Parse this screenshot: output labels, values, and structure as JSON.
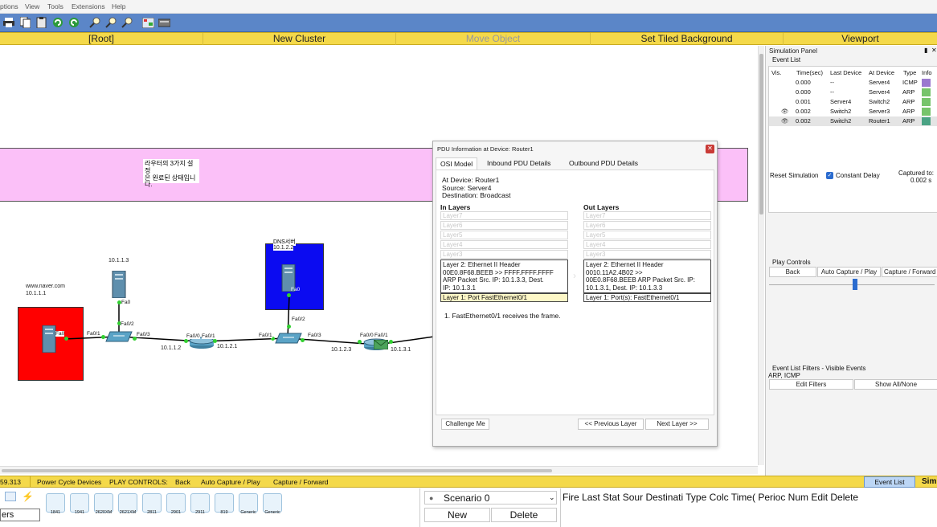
{
  "menu": [
    "ptions",
    "View",
    "Tools",
    "Extensions",
    "Help"
  ],
  "toolbar_icons": [
    "print-icon",
    "copy-icon",
    "paste-icon",
    "undo-icon",
    "redo-icon",
    "zoom-in-icon",
    "zoom-reset-icon",
    "zoom-out-icon",
    "palette-icon",
    "custom-device-icon"
  ],
  "nav": {
    "root": "[Root]",
    "new_cluster": "New Cluster",
    "move_object": "Move Object",
    "set_tiled_background": "Set Tiled Background",
    "viewport": "Viewport"
  },
  "workspace": {
    "note_text": [
      "라우터의 3가지 설정",
      "은 완료된 상태입니",
      "다."
    ],
    "labels": {
      "naver_host": "www.naver.com",
      "naver_ip": "10.1.1.1",
      "server_ip": "10.1.1.3",
      "dns_name": "DNS서버",
      "dns_ip": "10.1.2.2",
      "r1_ip_left": "10.1.1.2",
      "r1_ip_right": "10.1.2.1",
      "r2_ip_left": "10.1.2.3",
      "r2_ip_right": "10.1.3.1"
    },
    "ports": {
      "p_naver": "Fa0",
      "p_s1_left": "Fa0/1",
      "p_s1_top": "Fa0/2",
      "p_s1_right": "Fa0/3",
      "p_srv_bottom": "Fa0",
      "p_r1_left": "Fa0/0",
      "p_r1_right": "Fa0/1",
      "p_dns": "Fa0",
      "p_s2_left": "Fa0/1",
      "p_s2_top": "Fa0/2",
      "p_s2_right": "Fa0/3",
      "p_r2_left": "Fa0/0",
      "p_r2_right": "Fa0/1"
    }
  },
  "sim_panel": {
    "title": "Simulation Panel",
    "event_list_label": "Event List",
    "columns": [
      "Vis.",
      "Time(sec)",
      "Last Device",
      "At Device",
      "Type",
      "Info"
    ],
    "events": [
      {
        "vis": "",
        "time": "0.000",
        "last": "--",
        "at": "Server4",
        "type": "ICMP",
        "color": "#9b79cf"
      },
      {
        "vis": "",
        "time": "0.000",
        "last": "--",
        "at": "Server4",
        "type": "ARP",
        "color": "#77c46b"
      },
      {
        "vis": "",
        "time": "0.001",
        "last": "Server4",
        "at": "Switch2",
        "type": "ARP",
        "color": "#77c46b"
      },
      {
        "vis": "eye",
        "time": "0.002",
        "last": "Switch2",
        "at": "Server3",
        "type": "ARP",
        "color": "#77c46b"
      },
      {
        "vis": "eye",
        "time": "0.002",
        "last": "Switch2",
        "at": "Router1",
        "type": "ARP",
        "color": "#4aa384"
      }
    ],
    "reset_simulation": "Reset Simulation",
    "constant_delay": "Constant Delay",
    "captured_to": "Captured to:",
    "captured_value": "0.002 s",
    "play_controls": "Play Controls",
    "back": "Back",
    "auto_capture": "Auto Capture / Play",
    "capture_forward": "Capture / Forward",
    "filters_title": "Event List Filters - Visible Events",
    "filters_value": "ARP, ICMP",
    "edit_filters": "Edit Filters",
    "show_all": "Show All/None"
  },
  "dialog": {
    "title": "PDU Information at Device: Router1",
    "tabs": [
      "OSI Model",
      "Inbound PDU Details",
      "Outbound PDU Details"
    ],
    "at_device": "At Device: Router1",
    "source": "Source: Server4",
    "destination": "Destination: Broadcast",
    "in_layers_title": "In Layers",
    "out_layers_title": "Out Layers",
    "in_layers": [
      "Layer7",
      "Layer6",
      "Layer5",
      "Layer4",
      "Layer3"
    ],
    "out_layers": [
      "Layer7",
      "Layer6",
      "Layer5",
      "Layer4",
      "Layer3"
    ],
    "in_l2": [
      "Layer 2: Ethernet II Header",
      "00E0.8F68.BEEB >> FFFF.FFFF.FFFF",
      "ARP Packet Src. IP: 10.1.3.3, Dest.",
      "IP: 10.1.3.1"
    ],
    "out_l2": [
      "Layer 2: Ethernet II Header",
      "0010.11A2.4B02 >>",
      "00E0.8F68.BEEB ARP Packet Src. IP:",
      "10.1.3.1, Dest. IP: 10.1.3.3"
    ],
    "in_l1": "Layer 1: Port FastEthernet0/1",
    "out_l1": "Layer 1: Port(s): FastEthernet0/1",
    "description": "1. FastEthernet0/1 receives the frame.",
    "challenge": "Challenge Me",
    "prev_layer": "<< Previous Layer",
    "next_layer": "Next Layer >>"
  },
  "status": {
    "time": "59.313",
    "power_cycle": "Power Cycle Devices",
    "play_controls": "PLAY CONTROLS:",
    "back": "Back",
    "auto_capture": "Auto Capture / Play",
    "capture_forward": "Capture / Forward",
    "event_list_btn": "Event List",
    "sim_partial": "Sim"
  },
  "bottom": {
    "category_label": "ers",
    "devices": [
      "1841",
      "1941",
      "2620XM",
      "2621XM",
      "2811",
      "2901",
      "2911",
      "819",
      "Generic",
      "Generic"
    ],
    "scenario": "Scenario 0",
    "new": "New",
    "delete": "Delete",
    "pdu_columns": [
      "Fire",
      "Last Stat",
      "Sour",
      "Destinati",
      "Type",
      "Colc",
      "Time(",
      "Perioc",
      "Num",
      "Edit",
      "Delete"
    ]
  },
  "colors": {
    "toolbar": "#5b86c8",
    "yellow": "#f4d94a",
    "note": "#fbc0f8",
    "naver_area": "#ff0000",
    "dns_area": "#0b0bf1"
  }
}
